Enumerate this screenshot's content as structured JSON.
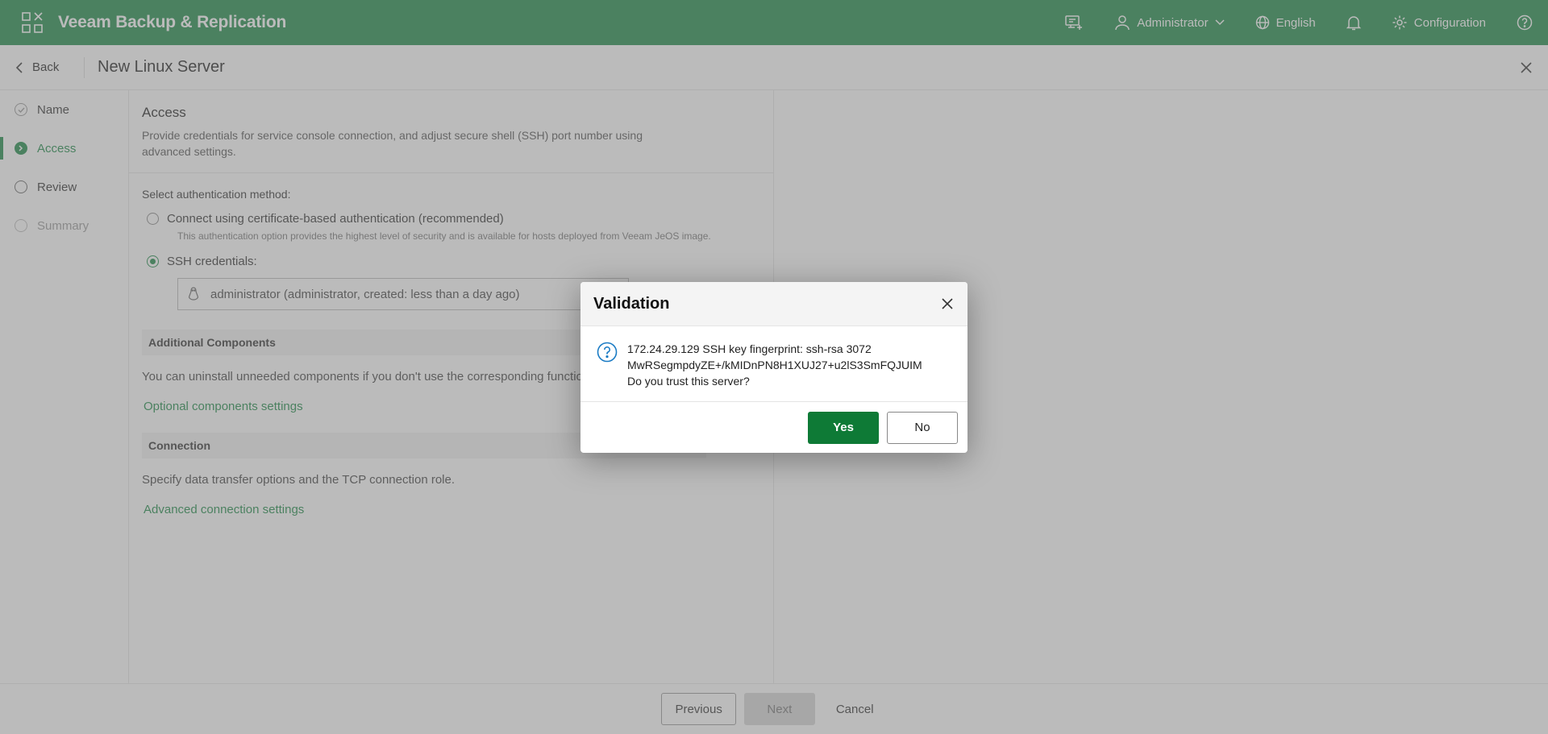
{
  "header": {
    "app_title": "Veeam Backup & Replication",
    "user": "Administrator",
    "language": "English",
    "configuration": "Configuration",
    "accent_color": "#1e8a48"
  },
  "subheader": {
    "back_label": "Back",
    "page_title": "New Linux Server"
  },
  "nav": {
    "items": [
      {
        "label": "Name",
        "state": "done"
      },
      {
        "label": "Access",
        "state": "active"
      },
      {
        "label": "Review",
        "state": "pending"
      },
      {
        "label": "Summary",
        "state": "disabled"
      }
    ]
  },
  "access": {
    "title": "Access",
    "description": "Provide credentials for service console connection, and adjust secure shell (SSH) port number using advanced settings.",
    "auth_label": "Select authentication method:",
    "option_cert": "Connect using certificate-based authentication (recommended)",
    "option_cert_hint": "This authentication option provides the highest level of security and is available for hosts deployed from Veeam JeOS image.",
    "option_ssh": "SSH credentials:",
    "credential_value": "administrator (administrator, created: less than a day ago)",
    "additional_title": "Additional Components",
    "additional_desc": "You can uninstall unneeded components if you don't use the corresponding functionality.",
    "optional_link": "Optional components settings",
    "connection_title": "Connection",
    "connection_desc": "Specify data transfer options and the TCP connection role.",
    "advanced_link": "Advanced connection settings"
  },
  "footer": {
    "previous": "Previous",
    "next": "Next",
    "cancel": "Cancel"
  },
  "dialog": {
    "title": "Validation",
    "line1": "172.24.29.129 SSH key fingerprint: ssh-rsa 3072",
    "line2": "MwRSegmpdyZE+/kMIDnPN8H1XUJ27+u2lS3SmFQJUIM",
    "line3": "Do you trust this server?",
    "yes": "Yes",
    "no": "No",
    "icon": "question-circle-icon",
    "icon_color": "#1a7bc4"
  }
}
